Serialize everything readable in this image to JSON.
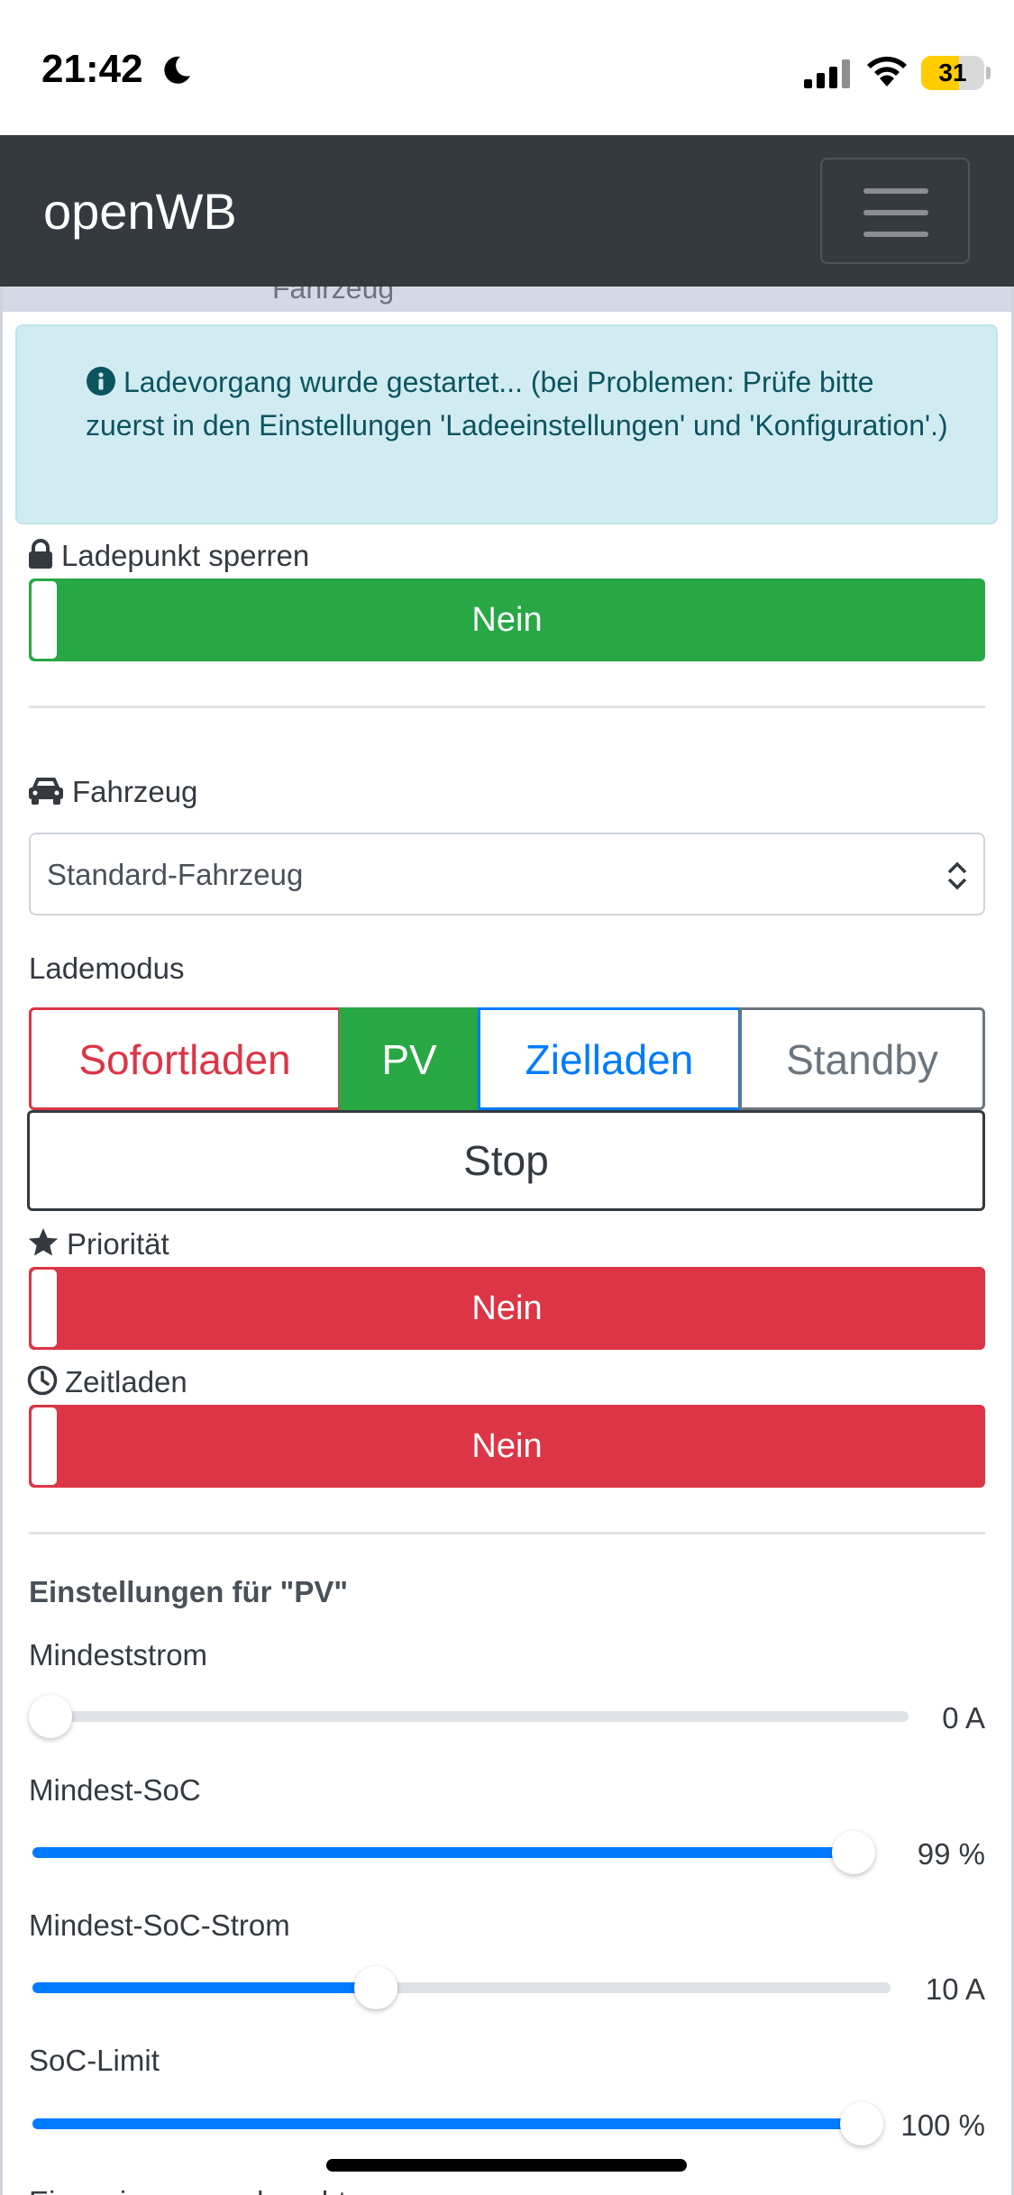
{
  "status_bar": {
    "time": "21:42",
    "battery": "31"
  },
  "navbar": {
    "brand": "openWB"
  },
  "peek_header": "Fahrzeug",
  "alert": {
    "text": "Ladevorgang wurde gestartet... (bei Problemen: Prüfe bitte zuerst in den Einstellungen 'Ladeeinstellungen' und 'Konfiguration'.)"
  },
  "lock": {
    "label": "Ladepunkt sperren",
    "value": "Nein",
    "state_color": "#28a745"
  },
  "vehicle": {
    "label": "Fahrzeug",
    "selected": "Standard-Fahrzeug"
  },
  "charge_mode": {
    "label": "Lademodus",
    "options": [
      "Sofortladen",
      "PV",
      "Zielladen",
      "Standby",
      "Stop"
    ],
    "selected": "PV"
  },
  "priority": {
    "label": "Priorität",
    "value": "Nein",
    "state_color": "#dc3545"
  },
  "time_charging": {
    "label": "Zeitladen",
    "value": "Nein",
    "state_color": "#dc3545"
  },
  "pv_settings": {
    "title": "Einstellungen für \"PV\"",
    "sliders": [
      {
        "label": "Mindeststrom",
        "value": "0 A",
        "fraction": 0.0
      },
      {
        "label": "Mindest-SoC",
        "value": "99 %",
        "fraction": 0.99
      },
      {
        "label": "Mindest-SoC-Strom",
        "value": "10 A",
        "fraction": 0.4
      },
      {
        "label": "SoC-Limit",
        "value": "100 %",
        "fraction": 1.0
      }
    ],
    "next_label": "Einspeisegrenze beachten"
  },
  "colors": {
    "accent": "#007bff",
    "success": "#28a745",
    "danger": "#dc3545",
    "navbar": "#343a40"
  }
}
